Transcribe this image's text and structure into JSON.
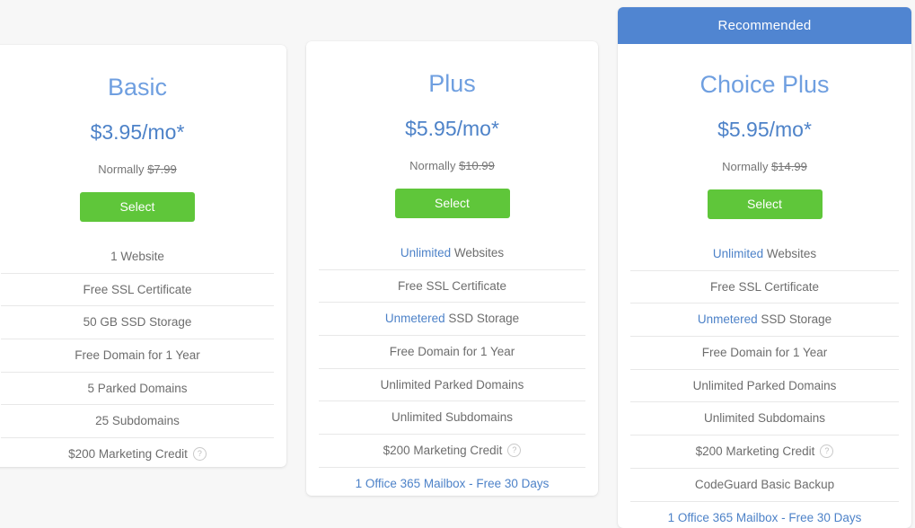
{
  "plans": [
    {
      "name": "Basic",
      "price": "$3.95/mo*",
      "normally_label": "Normally",
      "normally_price": "$7.99",
      "select_label": "Select",
      "features": [
        {
          "highlight": "",
          "text": "1 Website",
          "help": false,
          "link": false
        },
        {
          "highlight": "",
          "text": "Free SSL Certificate",
          "help": false,
          "link": false
        },
        {
          "highlight": "",
          "text": "50 GB SSD Storage",
          "help": false,
          "link": false
        },
        {
          "highlight": "",
          "text": "Free Domain for 1 Year",
          "help": false,
          "link": false
        },
        {
          "highlight": "",
          "text": "5 Parked Domains",
          "help": false,
          "link": false
        },
        {
          "highlight": "",
          "text": "25 Subdomains",
          "help": false,
          "link": false
        },
        {
          "highlight": "",
          "text": "$200 Marketing Credit",
          "help": true,
          "link": false
        }
      ]
    },
    {
      "name": "Plus",
      "price": "$5.95/mo*",
      "normally_label": "Normally",
      "normally_price": "$10.99",
      "select_label": "Select",
      "features": [
        {
          "highlight": "Unlimited",
          "text": " Websites",
          "help": false,
          "link": false
        },
        {
          "highlight": "",
          "text": "Free SSL Certificate",
          "help": false,
          "link": false
        },
        {
          "highlight": "Unmetered",
          "text": " SSD Storage",
          "help": false,
          "link": false
        },
        {
          "highlight": "",
          "text": "Free Domain for 1 Year",
          "help": false,
          "link": false
        },
        {
          "highlight": "",
          "text": "Unlimited Parked Domains",
          "help": false,
          "link": false
        },
        {
          "highlight": "",
          "text": "Unlimited Subdomains",
          "help": false,
          "link": false
        },
        {
          "highlight": "",
          "text": "$200 Marketing Credit",
          "help": true,
          "link": false
        },
        {
          "highlight": "",
          "text": "1 Office 365 Mailbox - Free 30 Days",
          "help": false,
          "link": true
        }
      ]
    },
    {
      "name": "Choice Plus",
      "badge": "Recommended",
      "price": "$5.95/mo*",
      "normally_label": "Normally",
      "normally_price": "$14.99",
      "select_label": "Select",
      "features": [
        {
          "highlight": "Unlimited",
          "text": " Websites",
          "help": false,
          "link": false
        },
        {
          "highlight": "",
          "text": "Free SSL Certificate",
          "help": false,
          "link": false
        },
        {
          "highlight": "Unmetered",
          "text": " SSD Storage",
          "help": false,
          "link": false
        },
        {
          "highlight": "",
          "text": "Free Domain for 1 Year",
          "help": false,
          "link": false
        },
        {
          "highlight": "",
          "text": "Unlimited Parked Domains",
          "help": false,
          "link": false
        },
        {
          "highlight": "",
          "text": "Unlimited Subdomains",
          "help": false,
          "link": false
        },
        {
          "highlight": "",
          "text": "$200 Marketing Credit",
          "help": true,
          "link": false
        },
        {
          "highlight": "",
          "text": "CodeGuard Basic Backup",
          "help": false,
          "link": false
        },
        {
          "highlight": "",
          "text": "1 Office 365 Mailbox - Free 30 Days",
          "help": false,
          "link": true
        }
      ]
    }
  ],
  "icons": {
    "help": "?"
  },
  "colors": {
    "accent_blue": "#4d82c8",
    "title_blue": "#6f9fe0",
    "banner_blue": "#5085d1",
    "select_green": "#5fc63a",
    "page_background": "#f7f7f7",
    "card_background": "#ffffff",
    "divider": "#e8e8e8",
    "body_text": "#6d6d6d"
  }
}
